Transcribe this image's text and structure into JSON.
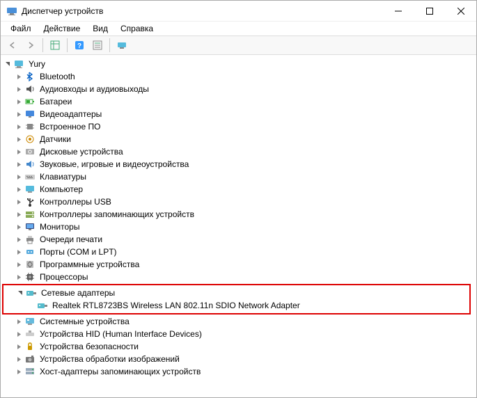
{
  "window": {
    "title": "Диспетчер устройств"
  },
  "menu": {
    "file": "Файл",
    "action": "Действие",
    "view": "Вид",
    "help": "Справка"
  },
  "tree": {
    "root": "Yury",
    "items": [
      {
        "label": "Bluetooth",
        "icon": "bluetooth"
      },
      {
        "label": "Аудиовходы и аудиовыходы",
        "icon": "audio"
      },
      {
        "label": "Батареи",
        "icon": "battery"
      },
      {
        "label": "Видеоадаптеры",
        "icon": "display"
      },
      {
        "label": "Встроенное ПО",
        "icon": "chip"
      },
      {
        "label": "Датчики",
        "icon": "sensor"
      },
      {
        "label": "Дисковые устройства",
        "icon": "disk"
      },
      {
        "label": "Звуковые, игровые и видеоустройства",
        "icon": "sound"
      },
      {
        "label": "Клавиатуры",
        "icon": "keyboard"
      },
      {
        "label": "Компьютер",
        "icon": "computer"
      },
      {
        "label": "Контроллеры USB",
        "icon": "usb"
      },
      {
        "label": "Контроллеры запоминающих устройств",
        "icon": "storage-ctrl"
      },
      {
        "label": "Мониторы",
        "icon": "monitor"
      },
      {
        "label": "Очереди печати",
        "icon": "printer"
      },
      {
        "label": "Порты (COM и LPT)",
        "icon": "port"
      },
      {
        "label": "Программные устройства",
        "icon": "software"
      },
      {
        "label": "Процессоры",
        "icon": "processor"
      }
    ],
    "network": {
      "label": "Сетевые адаптеры",
      "child": "Realtek RTL8723BS Wireless LAN 802.11n SDIO Network Adapter"
    },
    "items_after": [
      {
        "label": "Системные устройства",
        "icon": "system"
      },
      {
        "label": "Устройства HID (Human Interface Devices)",
        "icon": "hid"
      },
      {
        "label": "Устройства безопасности",
        "icon": "security"
      },
      {
        "label": "Устройства обработки изображений",
        "icon": "imaging"
      },
      {
        "label": "Хост-адаптеры запоминающих устройств",
        "icon": "host-storage"
      }
    ]
  }
}
